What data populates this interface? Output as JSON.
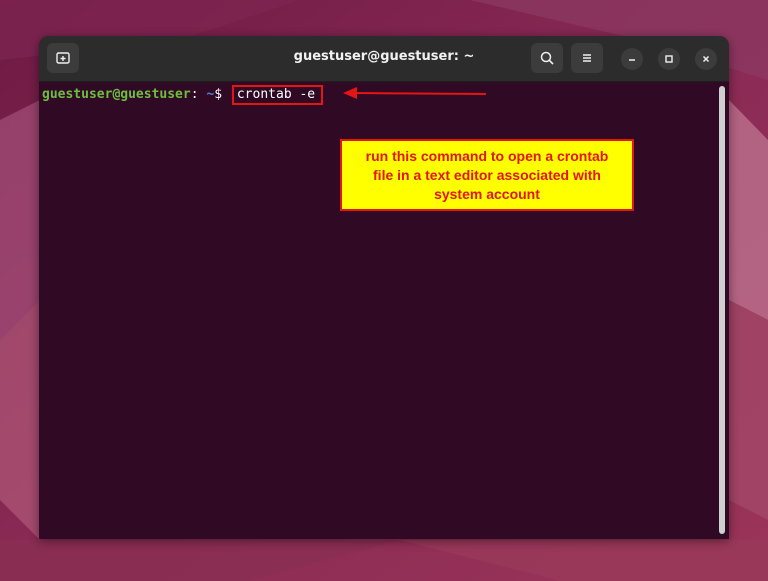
{
  "window": {
    "title": "guestuser@guestuser: ~"
  },
  "terminal": {
    "prompt_user": "guestuser@guestuser",
    "prompt_sep": ":",
    "prompt_path": " ~",
    "prompt_symbol": "$ ",
    "command": "crontab -e"
  },
  "annotation": {
    "lines": [
      "run this command to open a crontab",
      "file in a text editor associated with",
      "system account"
    ]
  },
  "icons": {
    "new_tab": "new-tab-icon",
    "search": "search-icon",
    "menu": "hamburger-menu-icon",
    "minimize": "minimize-icon",
    "maximize": "maximize-icon",
    "close": "close-icon"
  },
  "colors": {
    "terminal_bg": "#300a24",
    "titlebar_bg": "#2c2c2c",
    "prompt_user": "#6cbf3e",
    "prompt_path": "#4f7fd6",
    "annotation_red": "#e31515",
    "annotation_yellow": "#ffff00"
  }
}
